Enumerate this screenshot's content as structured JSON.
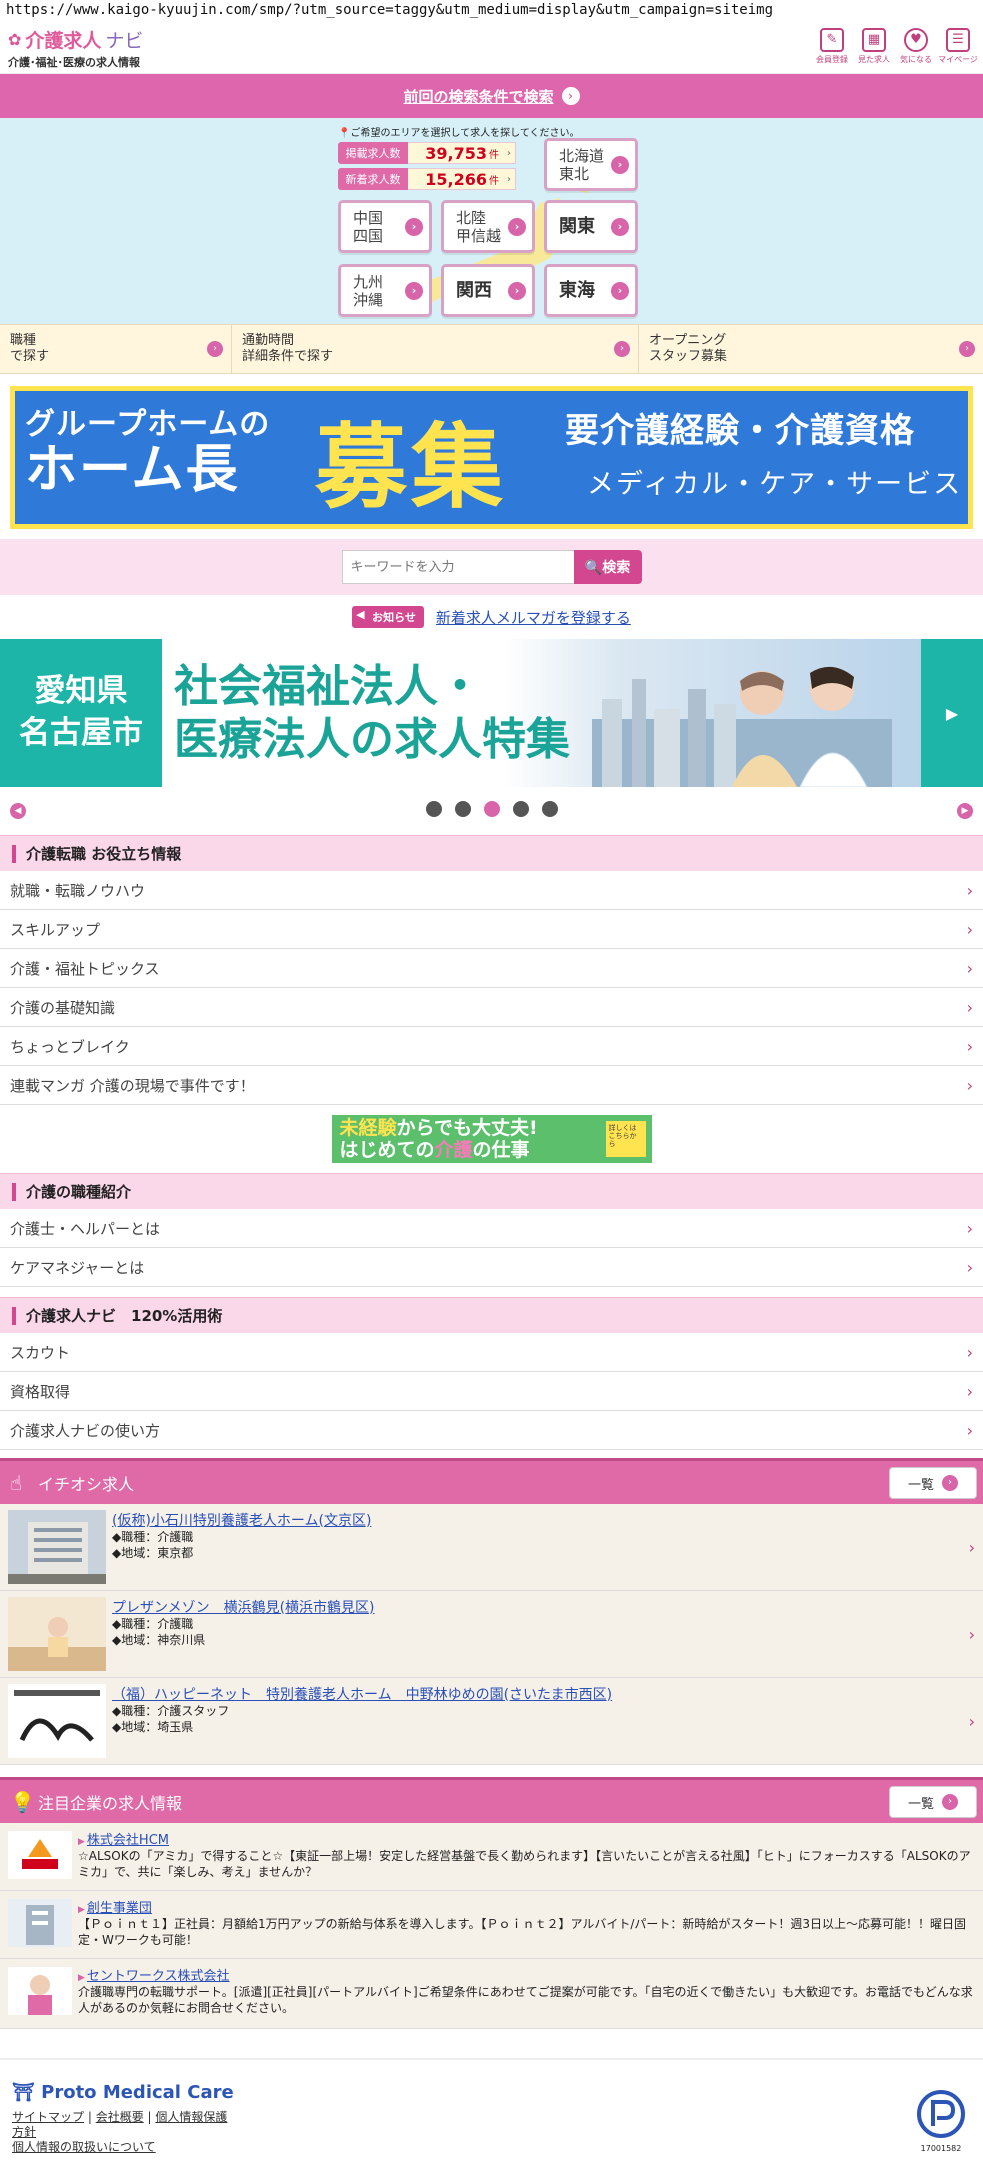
{
  "url": "https://www.kaigo-kyuujin.com/smp/?utm_source=taggy&utm_medium=display&utm_campaign=siteimg",
  "header": {
    "logo_main": "介護求人",
    "logo_navi": "ナビ",
    "logo_sub": "介護･福祉･医療の求人情報",
    "icons": [
      {
        "label": "会員登録",
        "icon": "pencil-icon"
      },
      {
        "label": "見た求人",
        "icon": "calendar-icon"
      },
      {
        "label": "気になる",
        "icon": "heart-icon"
      },
      {
        "label": "マイページ",
        "icon": "mypage-icon"
      }
    ]
  },
  "prev_search": "前回の検索条件で検索",
  "map": {
    "note": "ご希望のエリアを選択して求人を探してください。",
    "count_label": "掲載求人数",
    "count_value": "39,753",
    "new_label": "新着求人数",
    "new_value": "15,266",
    "unit": "件",
    "regions": [
      "北海道\n東北",
      "中国\n四国",
      "北陸\n甲信越",
      "関東",
      "九州\n沖縄",
      "関西",
      "東海"
    ]
  },
  "sub_links": [
    "職種\nで探す",
    "通勤時間\n詳細条件で探す",
    "オープニング\nスタッフ募集"
  ],
  "banner1": {
    "line1": "グループホームの",
    "line2": "ホーム長",
    "big": "募集",
    "right1": "要介護経験・介護資格",
    "right2": "メディカル・ケア・サービス"
  },
  "search": {
    "placeholder": "キーワードを入力",
    "button": "検索"
  },
  "notice": {
    "tag": "お知らせ",
    "link": "新着求人メルマガを登録する"
  },
  "banner2": {
    "left": "愛知県\n名古屋市",
    "title": "社会福祉法人・\n医療法人の求人特集"
  },
  "slider": {
    "count": 5,
    "active": 2
  },
  "sections": [
    {
      "title": "介護転職 お役立ち情報",
      "items": [
        "就職・転職ノウハウ",
        "スキルアップ",
        "介護・福祉トピックス",
        "介護の基礎知識",
        "ちょっとブレイク",
        "連載マンガ 介護の現場で事件です！"
      ]
    },
    {
      "title": "介護の職種紹介",
      "items": [
        "介護士・ヘルパーとは",
        "ケアマネジャーとは"
      ]
    },
    {
      "title": "介護求人ナビ　120%活用術",
      "items": [
        "スカウト",
        "資格取得",
        "介護求人ナビの使い方"
      ]
    }
  ],
  "mini_banner": {
    "line1a": "未経験",
    "line1b": "からでも大丈夫!",
    "line2a": "はじめての",
    "line2b": "介護",
    "line2c": "の仕事",
    "tag": "詳しくはこちらから"
  },
  "pickup": {
    "title": "イチオシ求人",
    "list_label": "一覧",
    "jobs": [
      {
        "title": "(仮称)小石川特別養護老人ホーム(文京区)",
        "job": "◆職種：介護職",
        "area": "◆地域：東京都"
      },
      {
        "title": "プレザンメゾン　横浜鶴見(横浜市鶴見区)",
        "job": "◆職種：介護職",
        "area": "◆地域：神奈川県"
      },
      {
        "title": "（福）ハッピーネット　特別養護老人ホーム　中野林ゆめの園(さいたま市西区)",
        "job": "◆職種：介護スタッフ",
        "area": "◆地域：埼玉県"
      }
    ]
  },
  "companies_section": {
    "title": "注目企業の求人情報",
    "list_label": "一覧",
    "companies": [
      {
        "name": "株式会社HCM",
        "desc": "☆ALSOKの「アミカ」で得すること☆【東証一部上場！安定した経営基盤で長く勤められます】【言いたいことが言える社風】「ヒト」にフォーカスする「ALSOKのアミカ」で、共に「楽しみ、考え」ませんか？"
      },
      {
        "name": "創生事業団",
        "desc": "【Ｐｏｉｎｔ１】正社員：月額給1万円アップの新給与体系を導入します。【Ｐｏｉｎｔ２】アルバイト/パート：新時給がスタート！週3日以上〜応募可能！！曜日固定・Wワークも可能！"
      },
      {
        "name": "セントワークス株式会社",
        "desc": "介護職専門の転職サポート。[派遣][正社員][パートアルバイト]ご希望条件にあわせてご提案が可能です。「自宅の近くで働きたい」も大歓迎です。お電話でもどんな求人があるのか気軽にお問合せください。"
      }
    ]
  },
  "footer": {
    "logo": "Proto Medical Care",
    "links": [
      "サイトマップ",
      "会社概要",
      "個人情報保護",
      "方針",
      "個人情報の取扱いについて"
    ],
    "privacy_number": "17001582"
  }
}
